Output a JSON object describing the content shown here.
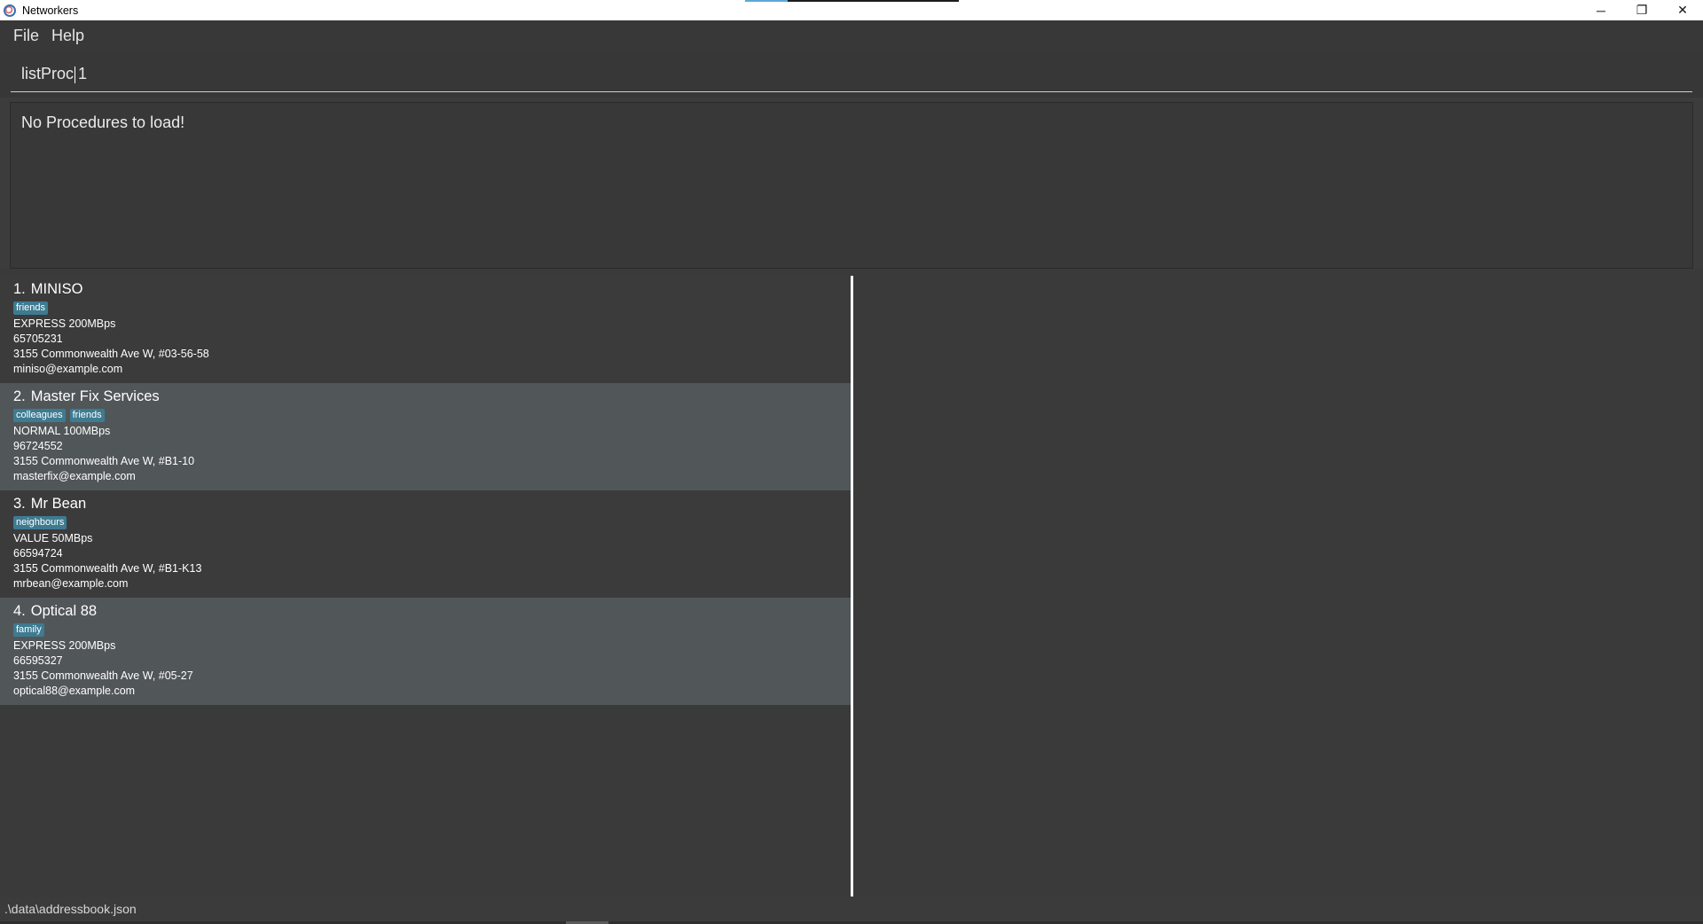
{
  "window": {
    "title": "Networkers",
    "controls": {
      "minimize": "─",
      "maximize": "❐",
      "close": "✕"
    }
  },
  "menu": {
    "items": [
      "File",
      "Help"
    ]
  },
  "command": {
    "value": "listProc 1"
  },
  "result": {
    "text": "No Procedures to load!"
  },
  "persons": [
    {
      "index": "1.",
      "name": "MINISO",
      "tags": [
        "friends"
      ],
      "plan": "EXPRESS 200MBps",
      "phone": "65705231",
      "address": "3155 Commonwealth Ave W, #03-56-58",
      "email": "miniso@example.com"
    },
    {
      "index": "2.",
      "name": "Master Fix Services",
      "tags": [
        "colleagues",
        "friends"
      ],
      "plan": "NORMAL 100MBps",
      "phone": "96724552",
      "address": "3155 Commonwealth Ave W, #B1-10",
      "email": "masterfix@example.com"
    },
    {
      "index": "3.",
      "name": "Mr Bean",
      "tags": [
        "neighbours"
      ],
      "plan": "VALUE 50MBps",
      "phone": "66594724",
      "address": "3155 Commonwealth Ave W, #B1-K13",
      "email": "mrbean@example.com"
    },
    {
      "index": "4.",
      "name": "Optical 88",
      "tags": [
        "family"
      ],
      "plan": "EXPRESS 200MBps",
      "phone": "66595327",
      "address": "3155 Commonwealth Ave W, #05-27",
      "email": "optical88@example.com"
    }
  ],
  "status": {
    "path": ".\\data\\addressbook.json"
  },
  "colors": {
    "tag": "#3e7b91",
    "background": "#3c3c3c",
    "card_alt": "#515659"
  }
}
